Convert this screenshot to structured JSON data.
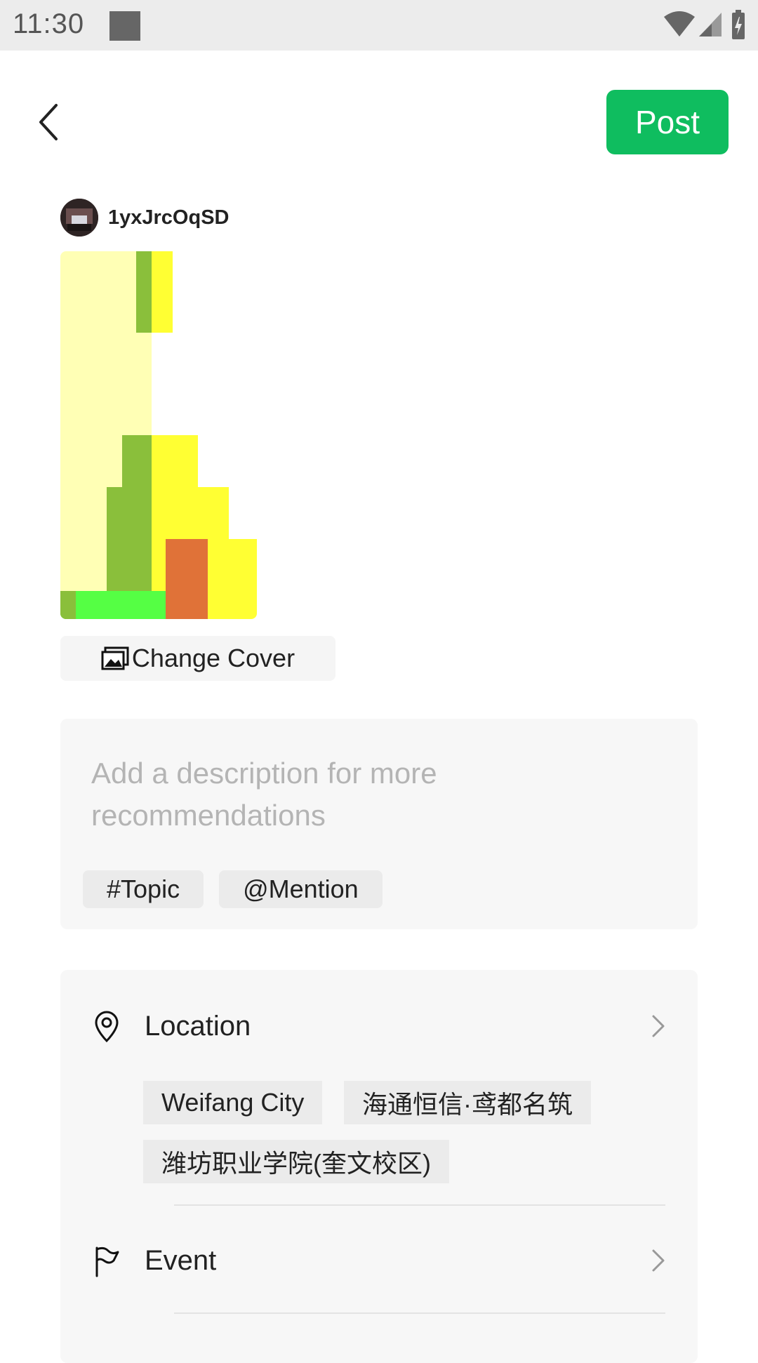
{
  "status_bar": {
    "time": "11:30"
  },
  "header": {
    "back_icon": "chevron-left-icon",
    "post_label": "Post",
    "post_color": "#0fbd5f"
  },
  "user": {
    "username": "1yxJrcOqSD"
  },
  "cover": {
    "change_cover_label": "Change Cover",
    "change_cover_icon": "image-icon"
  },
  "description": {
    "placeholder": "Add a description for more recommendations",
    "chips": [
      "#Topic",
      "@Mention"
    ]
  },
  "options": {
    "location": {
      "label": "Location",
      "icon": "location-pin-icon",
      "suggestions": [
        "Weifang City",
        "海通恒信·鸢都名筑",
        "潍坊职业学院(奎文校区)"
      ]
    },
    "event": {
      "label": "Event",
      "icon": "flag-icon"
    }
  }
}
